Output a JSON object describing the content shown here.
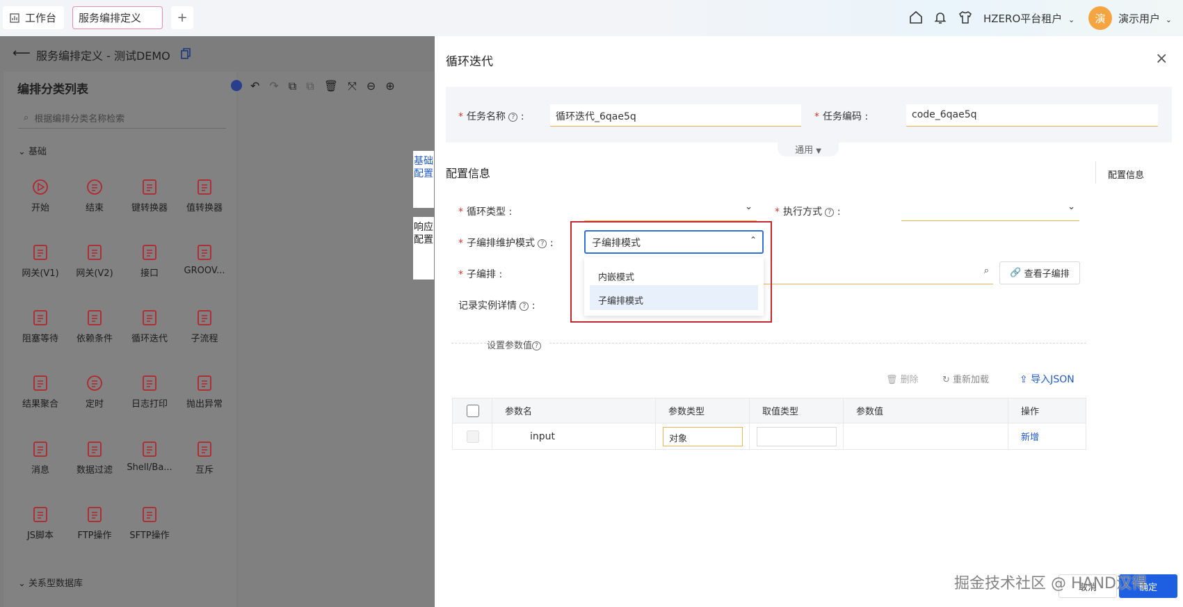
{
  "topbar": {
    "workbench_label": "工作台",
    "active_tab_label": "服务编排定义",
    "add_tab_label": "+",
    "tenant_label": "HZERO平台租户",
    "avatar_text": "演",
    "user_label": "演示用户"
  },
  "page": {
    "title": "服务编排定义 - 测试DEMO"
  },
  "category_panel": {
    "title": "编排分类列表",
    "search_placeholder": "根据编排分类名称检索",
    "group_basic": "基础",
    "group_rdb": "关系型数据库",
    "nodes": [
      {
        "label": "开始",
        "icon": "play-circle-icon"
      },
      {
        "label": "结束",
        "icon": "stop-circle-icon"
      },
      {
        "label": "键转换器",
        "icon": "key-convert-icon"
      },
      {
        "label": "值转换器",
        "icon": "code-convert-icon"
      },
      {
        "label": "网关(V1)",
        "icon": "gateway-v1-icon"
      },
      {
        "label": "网关(V2)",
        "icon": "gateway-v2-icon"
      },
      {
        "label": "接口",
        "icon": "link-icon"
      },
      {
        "label": "GROOV...",
        "icon": "scroll-icon"
      },
      {
        "label": "阻塞等待",
        "icon": "hourglass-icon"
      },
      {
        "label": "依赖条件",
        "icon": "dependency-icon"
      },
      {
        "label": "循环迭代",
        "icon": "loop-icon"
      },
      {
        "label": "子流程",
        "icon": "subflow-icon"
      },
      {
        "label": "结果聚合",
        "icon": "aggregate-icon"
      },
      {
        "label": "定时",
        "icon": "timer-icon"
      },
      {
        "label": "日志打印",
        "icon": "log-icon"
      },
      {
        "label": "抛出异常",
        "icon": "exception-icon"
      },
      {
        "label": "消息",
        "icon": "mail-icon"
      },
      {
        "label": "数据过滤",
        "icon": "filter-icon"
      },
      {
        "label": "Shell/Ba...",
        "icon": "shell-icon"
      },
      {
        "label": "互斥",
        "icon": "sliders-icon"
      },
      {
        "label": "JS脚本",
        "icon": "js-file-icon"
      },
      {
        "label": "FTP操作",
        "icon": "ftp-icon"
      },
      {
        "label": "SFTP操作",
        "icon": "sftp-icon"
      }
    ]
  },
  "side_tabs": {
    "basic_config": "基础配置",
    "response_config": "响应配置"
  },
  "drawer": {
    "title": "循环迭代",
    "close": "×",
    "task_name_label": "任务名称",
    "task_name_value": "循环迭代_6qae5q",
    "task_code_label": "任务编码",
    "task_code_value": "code_6qae5q",
    "general_toggle": "通用",
    "section_title": "配置信息",
    "anchor_label": "配置信息",
    "loop_type_label": "循环类型",
    "exec_mode_label": "执行方式",
    "sub_mode_label": "子编排维护模式",
    "sub_mode_value": "子编排模式",
    "sub_mode_options": [
      "内嵌模式",
      "子编排模式"
    ],
    "sub_flow_label": "子编排",
    "view_sub_button": "查看子编排",
    "record_detail_label": "记录实例详情",
    "param_section": "设置参数值",
    "delete_button": "删除",
    "reload_button": "重新加载",
    "import_json_button": "导入JSON",
    "table_headers": [
      "参数名",
      "参数类型",
      "取值类型",
      "参数值",
      "操作"
    ],
    "row": {
      "name": "input",
      "type": "对象",
      "value_type": "",
      "value": "",
      "action": "新增"
    },
    "cancel_button": "取消",
    "confirm_button": "确定",
    "watermark": "掘金技术社区 @ HAND汉得"
  }
}
